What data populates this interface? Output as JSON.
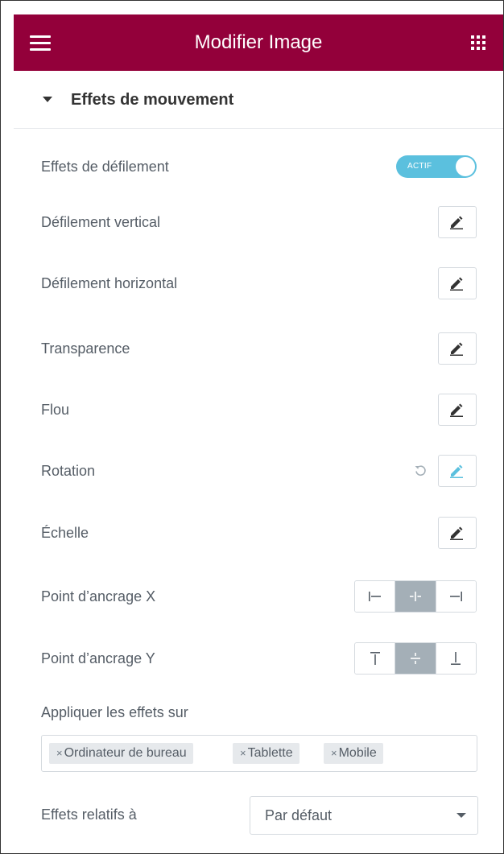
{
  "header": {
    "title": "Modifier Image"
  },
  "section": {
    "title": "Effets de mouvement"
  },
  "scroll_effects": {
    "label": "Effets de défilement",
    "toggle_text": "ACTIF",
    "enabled": true
  },
  "effects": [
    {
      "label": "Défilement vertical",
      "edit_icon": "pencil-icon"
    },
    {
      "label": "Défilement horizontal",
      "edit_icon": "pencil-icon"
    },
    {
      "label": "Transparence",
      "edit_icon": "pencil-icon"
    },
    {
      "label": "Flou",
      "edit_icon": "pencil-icon"
    },
    {
      "label": "Rotation",
      "edit_icon": "pencil-icon",
      "has_reset": true,
      "reset_icon": "reset-icon",
      "active": true
    },
    {
      "label": "Échelle",
      "edit_icon": "pencil-icon"
    }
  ],
  "anchor_x": {
    "label": "Point d’ancrage X",
    "options": [
      "left",
      "center",
      "right"
    ],
    "selected": "center"
  },
  "anchor_y": {
    "label": "Point d’ancrage Y",
    "options": [
      "top",
      "center",
      "bottom"
    ],
    "selected": "center"
  },
  "apply_on": {
    "label": "Appliquer les effets sur",
    "tags": [
      "Ordinateur de bureau",
      "Tablette",
      "Mobile"
    ],
    "remove_glyph": "×"
  },
  "relative_to": {
    "label": "Effets relatifs à",
    "value": "Par défaut"
  },
  "colors": {
    "header_bg": "#93003a",
    "toggle_bg": "#5bc0de",
    "active_icon": "#5bc0de",
    "segment_active": "#a4afb7"
  }
}
